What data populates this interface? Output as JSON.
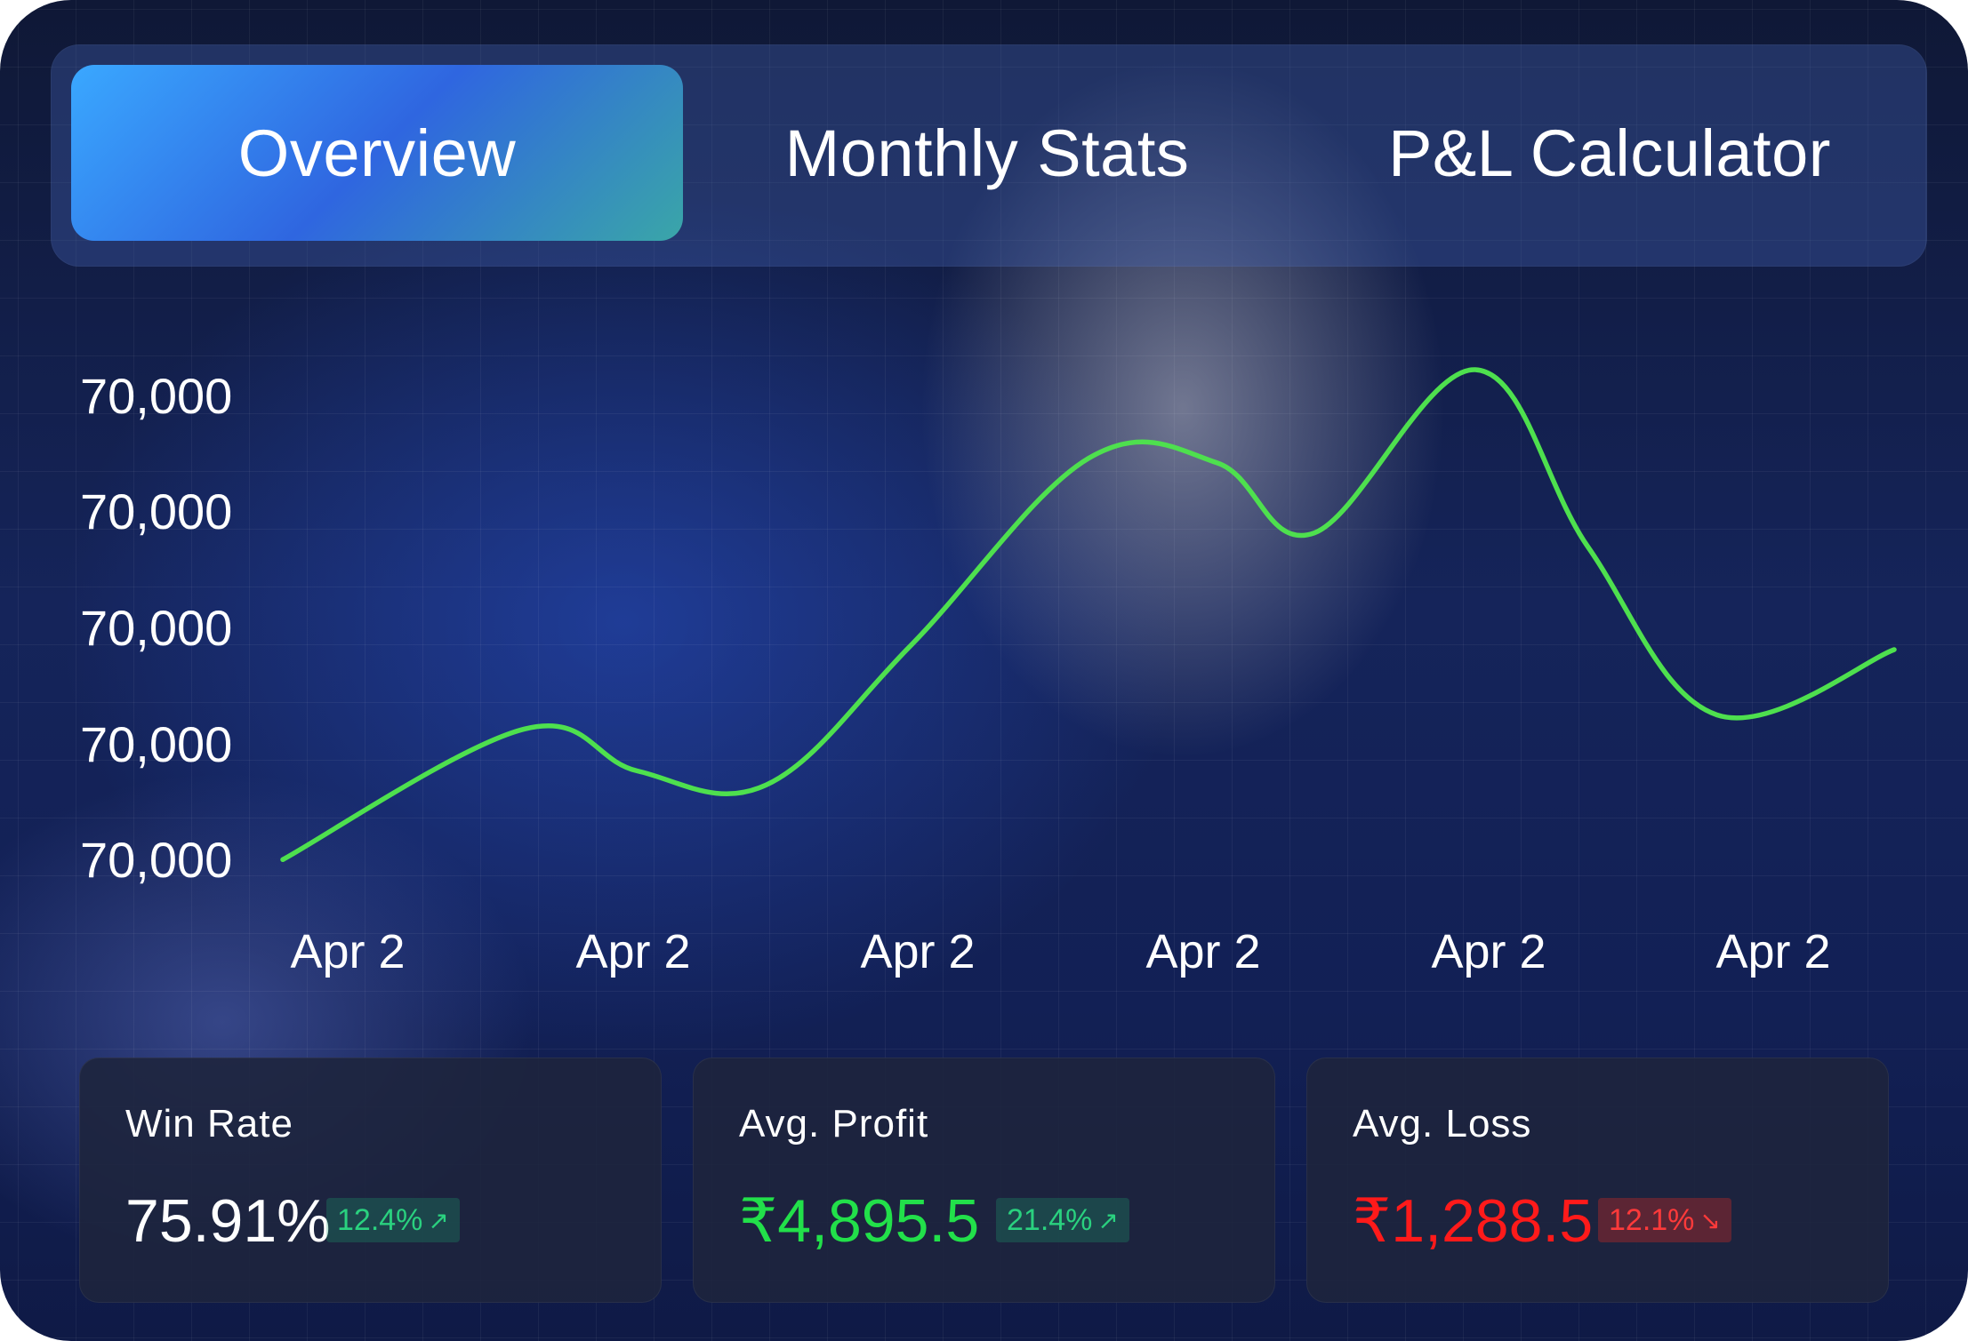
{
  "tabs": [
    {
      "label": "Overview",
      "active": true
    },
    {
      "label": "Monthly Stats",
      "active": false
    },
    {
      "label": "P&L Calculator",
      "active": false
    }
  ],
  "chart_data": {
    "type": "line",
    "y_tick_labels": [
      "70,000",
      "70,000",
      "70,000",
      "70,000",
      "70,000"
    ],
    "x_tick_labels": [
      "Apr 2",
      "Apr 2",
      "Apr 2",
      "Apr 2",
      "Apr 2",
      "Apr 2"
    ],
    "ylim": [
      0,
      100
    ],
    "xlim": [
      0,
      100
    ],
    "series": [
      {
        "color": "#4ee04e",
        "points": [
          [
            0,
            3
          ],
          [
            15,
            31
          ],
          [
            22,
            22
          ],
          [
            30,
            19
          ],
          [
            39,
            49
          ],
          [
            50,
            89
          ],
          [
            58,
            88
          ],
          [
            64,
            73
          ],
          [
            74,
            108
          ],
          [
            81,
            70
          ],
          [
            89,
            34
          ],
          [
            100,
            48
          ]
        ]
      }
    ],
    "grid": true
  },
  "stats": [
    {
      "label": "Win Rate",
      "value": "75.91%",
      "value_color": "#ffffff",
      "change": "12.4%",
      "direction": "up",
      "arrow": "↗"
    },
    {
      "label": "Avg. Profit",
      "value": "₹4,895.5",
      "value_color": "#22e04a",
      "change": "21.4%",
      "direction": "up",
      "arrow": "↗"
    },
    {
      "label": "Avg. Loss",
      "value": "₹1,288.5",
      "value_color": "#ff1a1a",
      "change": "12.1%",
      "direction": "down",
      "arrow": "↘"
    }
  ]
}
